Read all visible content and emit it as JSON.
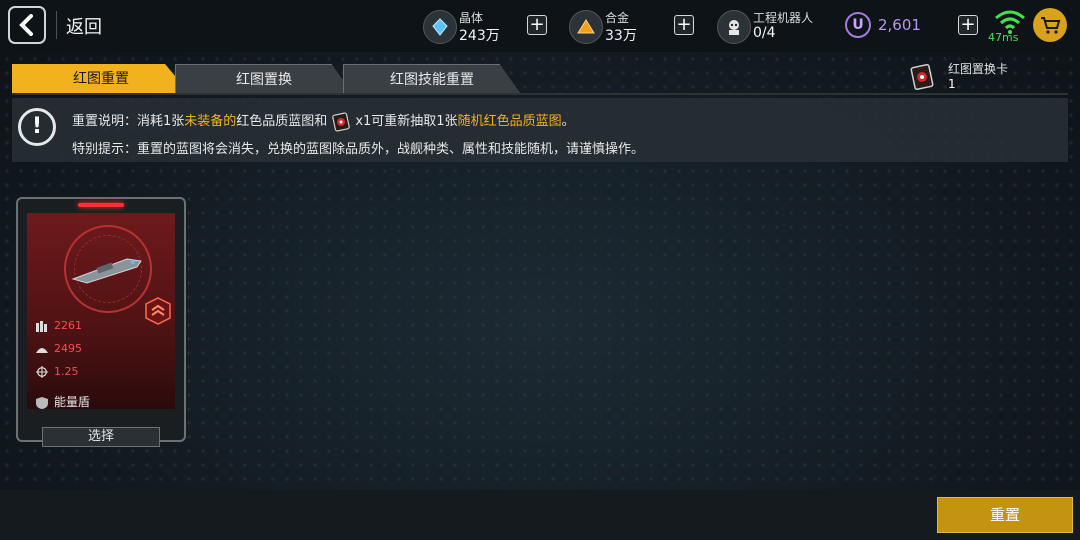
{
  "header": {
    "back_label": "返回",
    "resources": [
      {
        "name": "晶体",
        "value": "243万",
        "icon": "crystal-icon"
      },
      {
        "name": "合金",
        "value": "33万",
        "icon": "alloy-icon"
      },
      {
        "name": "工程机器人",
        "value": "0/4",
        "icon": "robot-icon"
      }
    ],
    "currency": {
      "symbol": "U",
      "value": "2,601"
    },
    "ping": "47ms"
  },
  "tabs": [
    {
      "label": "红图重置",
      "active": true
    },
    {
      "label": "红图置换",
      "active": false
    },
    {
      "label": "红图技能重置",
      "active": false
    }
  ],
  "card_counter": {
    "name": "红图置换卡",
    "value": "1"
  },
  "info": {
    "line1_a": "重置说明：消耗1张",
    "line1_b": "未装备的",
    "line1_c": "红色品质蓝图和",
    "line1_d": "x1可重新抽取1张",
    "line1_e": "随机红色品质蓝图",
    "line1_f": "。",
    "line2": "特别提示：重置的蓝图将会消失，兑换的蓝图除品质外，战舰种类、属性和技能随机，请谨慎操作。"
  },
  "ship_card": {
    "stat1": "2261",
    "stat2": "2495",
    "stat3": "1.25",
    "shield": "能量盾",
    "select_label": "选择"
  },
  "reset_button": "重置",
  "colors": {
    "accent": "#f2b21e",
    "red_stat": "#ff4b4b",
    "ping": "#46e04e",
    "currency": "#b995f2"
  }
}
